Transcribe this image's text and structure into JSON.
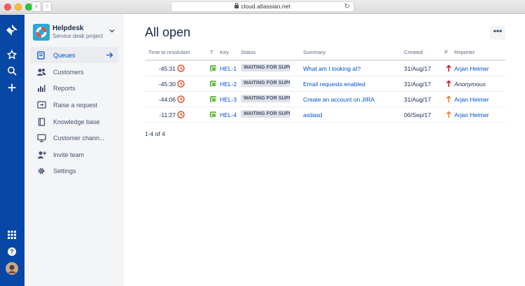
{
  "browser": {
    "url": "cloud.atlassian.net"
  },
  "project": {
    "name": "Helpdesk",
    "type": "Service desk project"
  },
  "sidebar": {
    "items": [
      {
        "label": "Queues",
        "icon": "queues-icon",
        "active": true
      },
      {
        "label": "Customers",
        "icon": "customers-icon"
      },
      {
        "label": "Reports",
        "icon": "reports-icon"
      },
      {
        "label": "Raise a request",
        "icon": "raise-request-icon"
      },
      {
        "label": "Knowledge base",
        "icon": "knowledge-base-icon"
      },
      {
        "label": "Customer chann...",
        "icon": "customer-channels-icon"
      },
      {
        "label": "Invite team",
        "icon": "invite-team-icon"
      },
      {
        "label": "Settings",
        "icon": "gear-icon"
      }
    ]
  },
  "main": {
    "title": "All open",
    "more_label": "•••",
    "columns": [
      "Time to resolution",
      "T",
      "Key",
      "Status",
      "Summary",
      "Created",
      "P",
      "Reporter"
    ],
    "rows": [
      {
        "time": "-45:31",
        "key": "HEL-1",
        "status": "WAITING FOR SUPP...",
        "summary": "What am I looking at?",
        "created": "31/Aug/17",
        "priority": "high",
        "reporter": "Arjan Helmer"
      },
      {
        "time": "-45:30",
        "key": "HEL-2",
        "status": "WAITING FOR SUPP...",
        "summary": "Email requests enabled",
        "created": "31/Aug/17",
        "priority": "high",
        "reporter": "Anonymous"
      },
      {
        "time": "-44:06",
        "key": "HEL-3",
        "status": "WAITING FOR SUPP...",
        "summary": "Create an account on JIRA",
        "created": "31/Aug/17",
        "priority": "medium",
        "reporter": "Arjan Helmer"
      },
      {
        "time": "-11:27",
        "key": "HEL-4",
        "status": "WAITING FOR SUPP...",
        "summary": "asdasd",
        "created": "06/Sep/17",
        "priority": "medium",
        "reporter": "Arjan Helmer"
      }
    ],
    "pagination": "1-4 of 4"
  },
  "colors": {
    "global_nav": "#0747A6",
    "link": "#0052CC",
    "sla_breached": "#DE350B",
    "priority_high": "#CD1317",
    "priority_medium": "#E97F33",
    "issue_type": "#6BBD47"
  }
}
